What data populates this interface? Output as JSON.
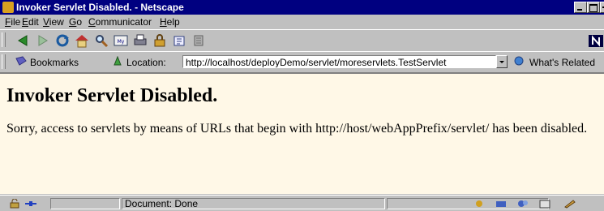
{
  "window": {
    "title": "Invoker Servlet Disabled. - Netscape"
  },
  "menu": [
    {
      "pre": "",
      "key": "F",
      "post": "ile"
    },
    {
      "pre": "",
      "key": "E",
      "post": "dit"
    },
    {
      "pre": "",
      "key": "V",
      "post": "iew"
    },
    {
      "pre": "",
      "key": "G",
      "post": "o"
    },
    {
      "pre": "",
      "key": "C",
      "post": "ommunicator"
    },
    {
      "pre": "",
      "key": "H",
      "post": "elp"
    }
  ],
  "navbar": {
    "icons": [
      "back-icon",
      "forward-icon",
      "reload-icon",
      "home-icon",
      "search-icon",
      "my-netscape-icon",
      "print-icon",
      "security-icon",
      "shop-icon",
      "stop-icon"
    ]
  },
  "locationbar": {
    "bookmarks_label": "Bookmarks",
    "location_label": "Location:",
    "url": "http://localhost/deployDemo/servlet/moreservlets.TestServlet",
    "related_label": "What's Related"
  },
  "page": {
    "heading": "Invoker Servlet Disabled.",
    "message": "Sorry, access to servlets by means of URLs that begin with http://host/webAppPrefix/servlet/ has been disabled."
  },
  "status": {
    "text": "Document: Done"
  },
  "colors": {
    "titlebar": "#000080",
    "chrome": "#c0c0c0",
    "content_bg": "#fff8e7"
  }
}
